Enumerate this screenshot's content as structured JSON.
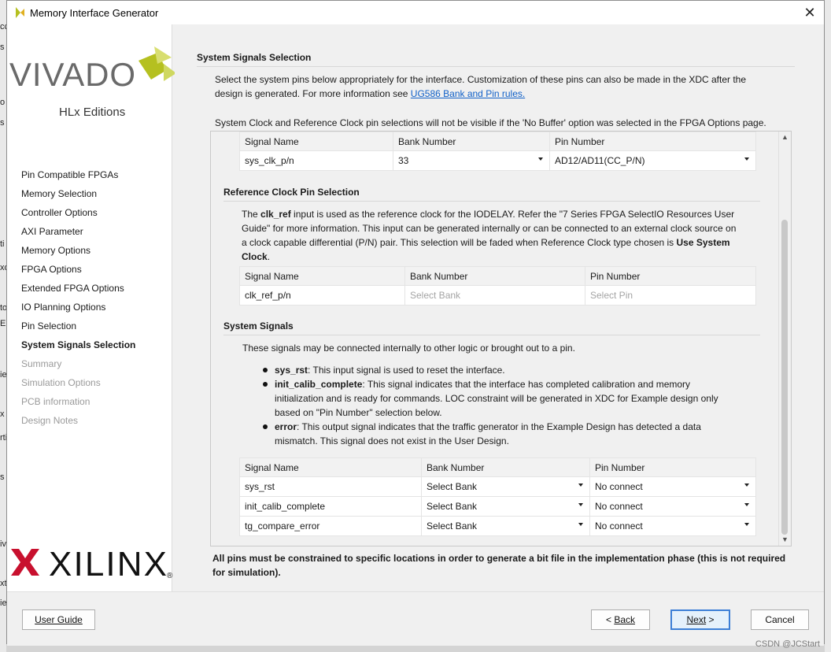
{
  "window": {
    "title": "Memory Interface Generator",
    "close_glyph": "✕"
  },
  "background_fragments": [
    "cc",
    "s",
    "o",
    "s",
    "ti",
    "xo",
    "to",
    "E",
    "ie",
    "x",
    "rti",
    "s",
    "iv",
    "xt",
    "ie"
  ],
  "sidebar": {
    "logo": {
      "brand": "VIVADO",
      "sub": "HLx Editions",
      "mark_color": "#b5c020"
    },
    "items": [
      {
        "label": "Pin Compatible FPGAs",
        "state": "normal"
      },
      {
        "label": "Memory Selection",
        "state": "normal"
      },
      {
        "label": "Controller Options",
        "state": "normal"
      },
      {
        "label": "AXI Parameter",
        "state": "normal"
      },
      {
        "label": "Memory Options",
        "state": "normal"
      },
      {
        "label": "FPGA Options",
        "state": "normal"
      },
      {
        "label": "Extended FPGA Options",
        "state": "normal"
      },
      {
        "label": "IO Planning Options",
        "state": "normal"
      },
      {
        "label": "Pin Selection",
        "state": "normal"
      },
      {
        "label": "System Signals Selection",
        "state": "active"
      },
      {
        "label": "Summary",
        "state": "disabled"
      },
      {
        "label": "Simulation Options",
        "state": "disabled"
      },
      {
        "label": "PCB information",
        "state": "disabled"
      },
      {
        "label": "Design Notes",
        "state": "disabled"
      }
    ],
    "vendor": {
      "name": "XILINX",
      "reg": "®",
      "mark_color": "#c8102e"
    }
  },
  "page": {
    "title": "System Signals Selection",
    "intro_1": "Select the system pins below appropriately for the interface. Customization of these pins can also be made in the XDC after the",
    "intro_2": "design is generated. For more information see ",
    "intro_link": "UG586 Bank and Pin rules.",
    "intro_note": "System Clock and Reference Clock pin selections will not be visible if the 'No Buffer' option was selected in the FPGA Options page.",
    "sysclk_table": {
      "headers": [
        "Signal Name",
        "Bank Number",
        "Pin Number"
      ],
      "row": {
        "signal": "sys_clk_p/n",
        "bank": "33",
        "pin": "AD12/AD11(CC_P/N)"
      }
    },
    "refclk": {
      "title": "Reference Clock Pin Selection",
      "text_1": "The ",
      "text_b1": "clk_ref",
      "text_2": " input is used as the reference clock for the IODELAY. Refer the \"7 Series FPGA SelectIO Resources User",
      "text_3": "Guide\" for more information. This input can be generated internally or can be connected to an external clock source on",
      "text_4": "a clock capable differential (P/N) pair. This selection will be faded when Reference Clock type chosen is ",
      "text_b2": "Use System",
      "text_b3": "Clock",
      "text_5": ".",
      "headers": [
        "Signal Name",
        "Bank Number",
        "Pin Number"
      ],
      "row": {
        "signal": "clk_ref_p/n",
        "bank": "Select Bank",
        "pin": "Select Pin"
      }
    },
    "system_signals": {
      "title": "System Signals",
      "intro": "These signals may be connected internally to other logic or brought out to a pin.",
      "b1_name": "sys_rst",
      "b1_text": ": This input signal is used to reset the interface.",
      "b2_name": "init_calib_complete",
      "b2_text_1": ": This signal indicates that the interface has completed calibration and memory",
      "b2_text_2": "initialization and is ready for commands. LOC constraint will be generated in XDC for Example design only",
      "b2_text_3": "based on \"Pin Number\" selection below.",
      "b3_name": "error",
      "b3_text_1": ": This output signal indicates that the traffic generator in the Example Design has detected a data",
      "b3_text_2": "mismatch. This signal does not exist in the User Design.",
      "headers": [
        "Signal Name",
        "Bank Number",
        "Pin Number"
      ],
      "rows": [
        {
          "signal": "sys_rst",
          "bank": "Select Bank",
          "pin": "No connect"
        },
        {
          "signal": "init_calib_complete",
          "bank": "Select Bank",
          "pin": "No connect"
        },
        {
          "signal": "tg_compare_error",
          "bank": "Select Bank",
          "pin": "No connect"
        }
      ]
    },
    "bottom_note_1": "All pins must be constrained to specific locations in order to generate a bit file in the implementation phase (this is not required",
    "bottom_note_2": "for simulation)."
  },
  "footer": {
    "user_guide": "User Guide",
    "back_prefix": "< ",
    "back_label": "Back",
    "next_label": "Next",
    "next_suffix": " >",
    "cancel": "Cancel"
  },
  "watermark": "CSDN @JCStart"
}
